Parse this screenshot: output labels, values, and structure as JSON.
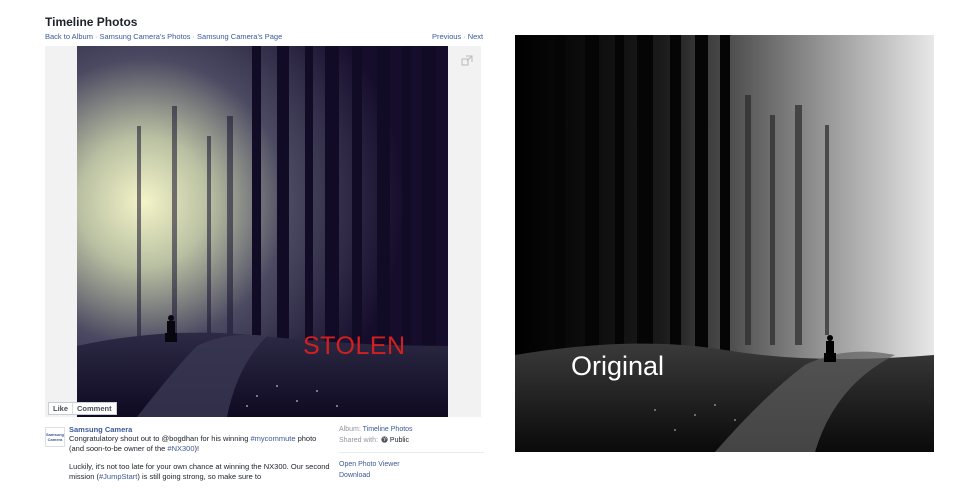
{
  "header": {
    "title": "Timeline Photos",
    "breadcrumb": {
      "back": "Back to Album",
      "photos": "Samsung Camera's Photos",
      "page": "Samsung Camera's Page",
      "separator": "·"
    },
    "pager": {
      "previous": "Previous",
      "next": "Next",
      "separator": "·"
    }
  },
  "photo": {
    "overlay_text": "STOLEN",
    "overlay_color": "#d41f1f"
  },
  "actions": {
    "like": "Like",
    "comment": "Comment"
  },
  "post": {
    "avatar_text": "Samsung Camera",
    "poster": "Samsung Camera",
    "line1_a": "Congratulatory shout out to @bogdhan for his winning ",
    "tag_mycommute": "#mycommute",
    "line1_b": " photo (and soon-to-be owner of the ",
    "tag_nx300": "#NX300",
    "line1_c": ")!",
    "line2_a": "Luckily, it's not too late for your own chance at winning the NX300. Our second mission (",
    "tag_jumpstart": "#JumpStart",
    "line2_b": ") is still going strong, so make sure to"
  },
  "meta": {
    "album_label": "Album:",
    "album_value": "Timeline Photos",
    "shared_label": "Shared with:",
    "shared_value": "Public",
    "open_viewer": "Open Photo Viewer",
    "download": "Download"
  },
  "original": {
    "label": "Original"
  },
  "icons": {
    "expand": "expand-icon",
    "globe": "globe-icon"
  },
  "colors": {
    "link": "#3b5998",
    "stolen": "#d41f1f",
    "text": "#1d2129"
  }
}
